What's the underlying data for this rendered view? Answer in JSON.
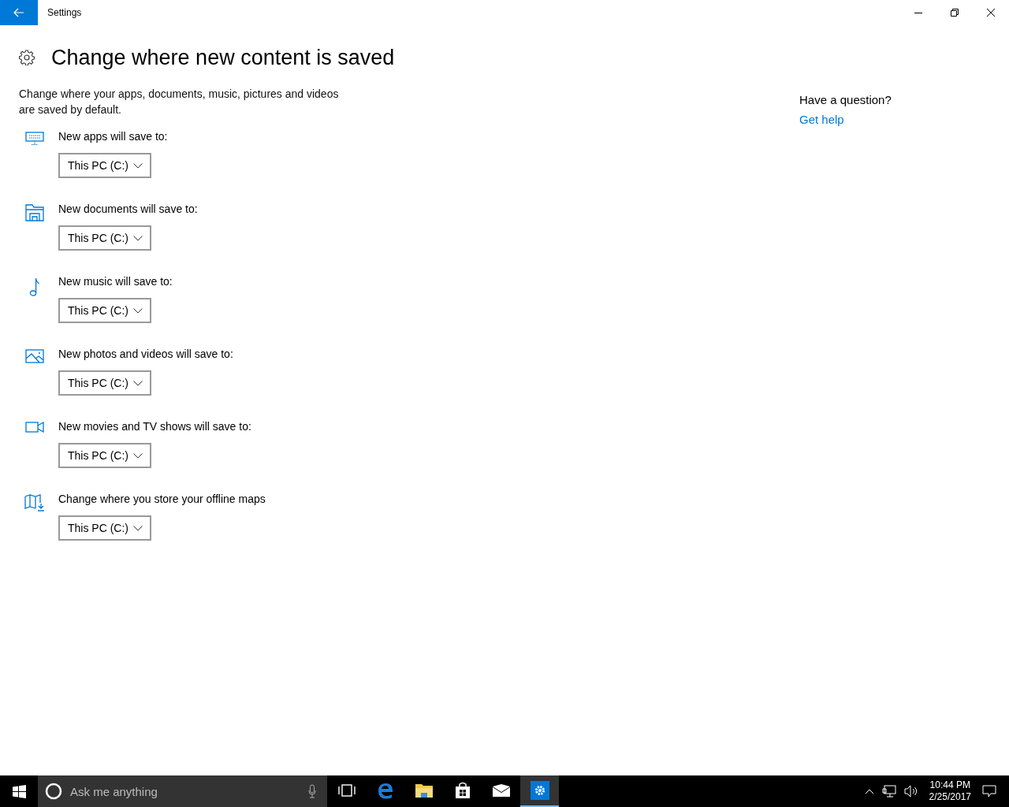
{
  "window": {
    "title": "Settings"
  },
  "page": {
    "heading": "Change where new content is saved",
    "description": "Change where your apps, documents, music, pictures and videos are saved by default."
  },
  "settings": [
    {
      "kind": "apps",
      "label": "New apps will save to:",
      "value": "This PC (C:)"
    },
    {
      "kind": "documents",
      "label": "New documents will save to:",
      "value": "This PC (C:)"
    },
    {
      "kind": "music",
      "label": "New music will save to:",
      "value": "This PC (C:)"
    },
    {
      "kind": "photos",
      "label": "New photos and videos will save to:",
      "value": "This PC (C:)"
    },
    {
      "kind": "movies",
      "label": "New movies and TV shows will save to:",
      "value": "This PC (C:)"
    },
    {
      "kind": "maps",
      "label": "Change where you store your offline maps",
      "value": "This PC (C:)"
    }
  ],
  "help": {
    "heading": "Have a question?",
    "link": "Get help"
  },
  "taskbar": {
    "search": {
      "placeholder": "Ask me anything"
    },
    "apps": [
      {
        "kind": "taskview",
        "selected": false
      },
      {
        "kind": "edge",
        "selected": false
      },
      {
        "kind": "explorer",
        "selected": false
      },
      {
        "kind": "store",
        "selected": false
      },
      {
        "kind": "mail",
        "selected": false
      },
      {
        "kind": "settings",
        "selected": true
      }
    ],
    "clock": {
      "time": "10:44 PM",
      "date": "2/25/2017"
    }
  }
}
